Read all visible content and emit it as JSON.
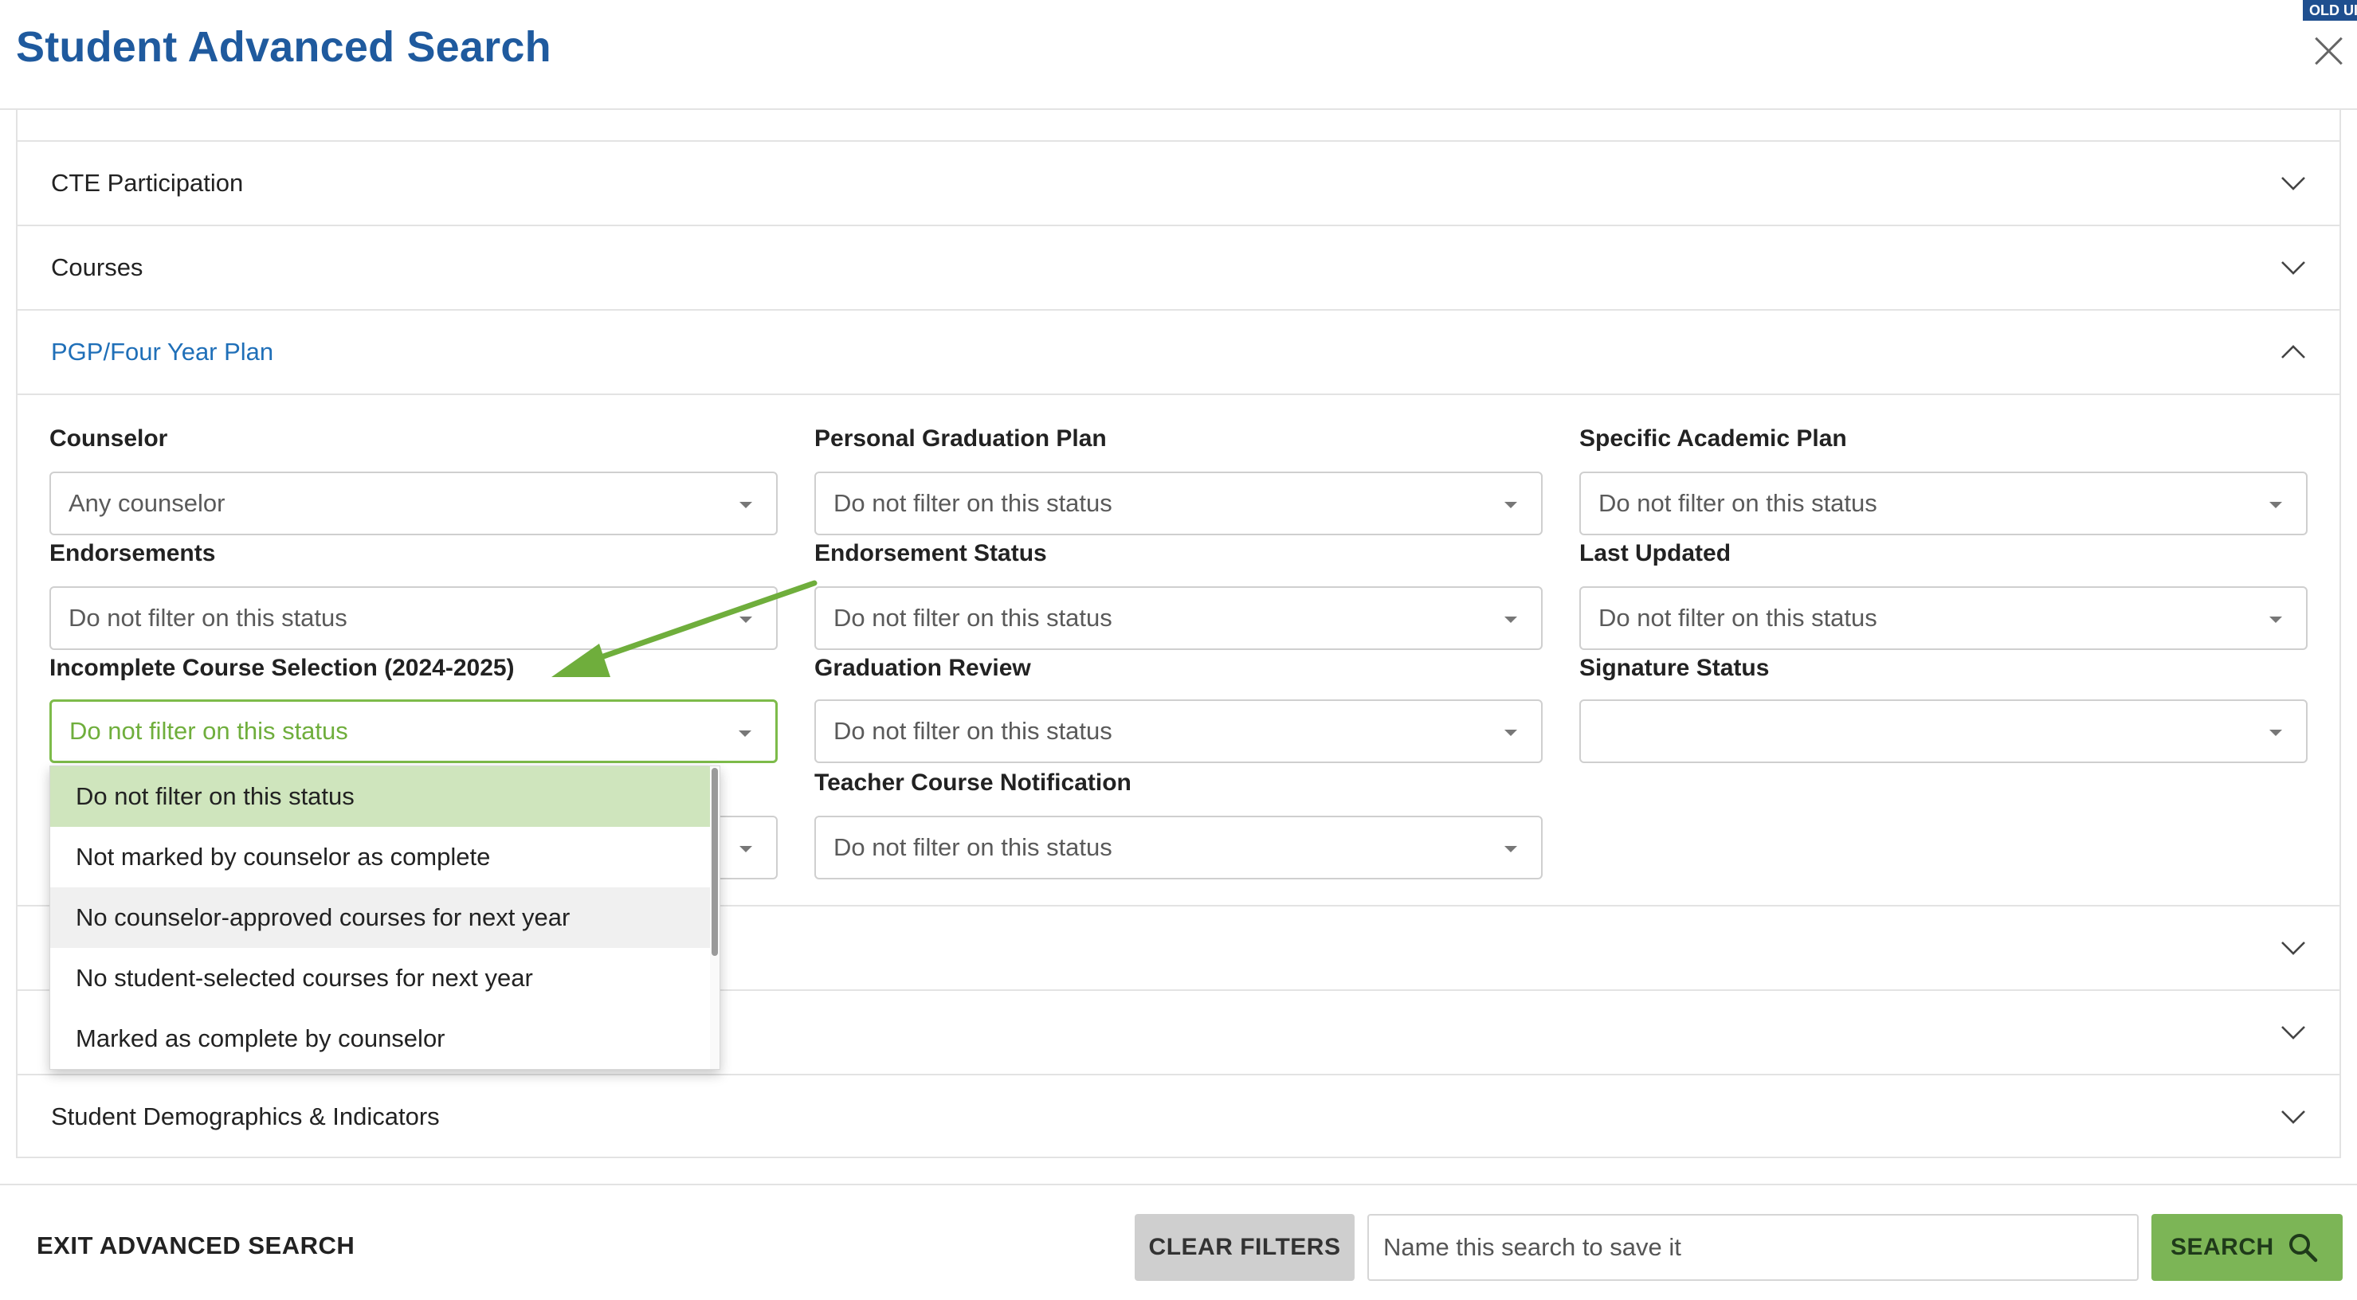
{
  "header": {
    "title": "Student Advanced Search",
    "badge": "OLD UI"
  },
  "accordion": {
    "sections_above": [
      {
        "label": "CTE Participation"
      },
      {
        "label": "Courses"
      }
    ],
    "active_section": {
      "label": "PGP/Four Year Plan"
    },
    "section_below_last": {
      "label": "Student Demographics & Indicators"
    }
  },
  "filters": {
    "counselor": {
      "label": "Counselor",
      "value": "Any counselor"
    },
    "personal_graduation_plan": {
      "label": "Personal Graduation Plan",
      "value": "Do not filter on this status"
    },
    "specific_academic_plan": {
      "label": "Specific Academic Plan",
      "value": "Do not filter on this status"
    },
    "endorsements": {
      "label": "Endorsements",
      "value": "Do not filter on this status"
    },
    "endorsement_status": {
      "label": "Endorsement Status",
      "value": "Do not filter on this status"
    },
    "last_updated": {
      "label": "Last Updated",
      "value": "Do not filter on this status"
    },
    "incomplete_course_selection": {
      "label": "Incomplete Course Selection (2024-2025)",
      "value": "Do not filter on this status"
    },
    "graduation_review": {
      "label": "Graduation Review",
      "value": "Do not filter on this status"
    },
    "signature_status": {
      "label": "Signature Status",
      "value": ""
    },
    "teacher_course_notification": {
      "label": "Teacher Course Notification",
      "value": "Do not filter on this status"
    }
  },
  "dropdown": {
    "options": [
      "Do not filter on this status",
      "Not marked by counselor as complete",
      "No counselor-approved courses for next year",
      "No student-selected courses for next year",
      "Marked as complete by counselor"
    ],
    "selected_index": 0,
    "hover_index": 2
  },
  "footer": {
    "exit_label": "EXIT ADVANCED SEARCH",
    "clear_label": "CLEAR FILTERS",
    "name_placeholder": "Name this search to save it",
    "search_label": "SEARCH"
  },
  "colors": {
    "title": "#1f5a9e",
    "active_section": "#1f6fb8",
    "focus_green": "#7dbb4a",
    "selected_option": "#cfe5bd",
    "search_button": "#7cb556",
    "annotation_arrow": "#6fae3c"
  },
  "icons": {
    "close": "close-icon",
    "chevron_down": "chevron-down-icon",
    "chevron_up": "chevron-up-icon",
    "search": "search-icon"
  }
}
